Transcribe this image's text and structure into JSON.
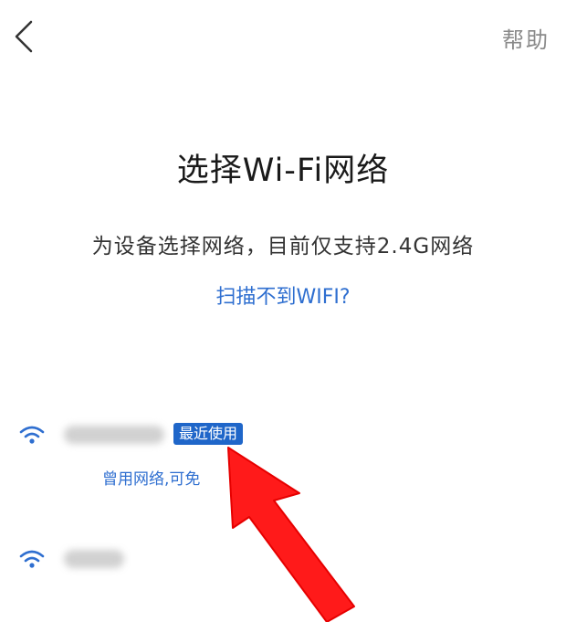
{
  "header": {
    "back_icon": "chevron-left-icon",
    "help_label": "帮助"
  },
  "main": {
    "title": "选择Wi-Fi网络",
    "subtitle": "为设备选择网络，目前仅支持2.4G网络",
    "scan_help_link": "扫描不到WIFI?"
  },
  "networks": [
    {
      "icon": "wifi-icon",
      "ssid_blurred": true,
      "badge": "最近使用",
      "hint": "曾用网络,可免"
    },
    {
      "icon": "wifi-icon",
      "ssid_blurred": true
    }
  ],
  "colors": {
    "accent": "#2f6fd0",
    "badge_bg": "#1f66c9",
    "annotation_arrow": "#ff1a1a"
  }
}
